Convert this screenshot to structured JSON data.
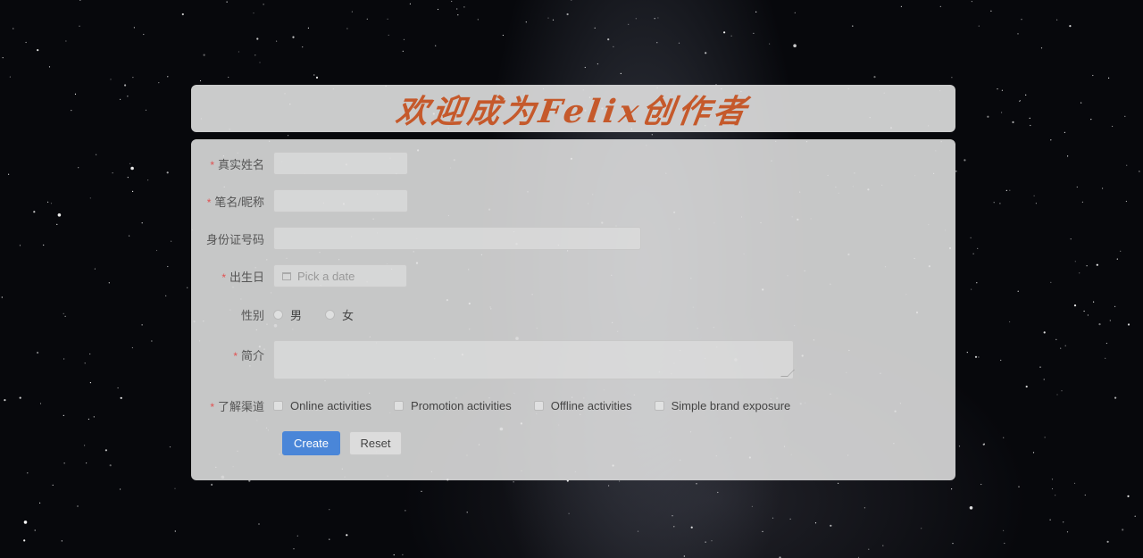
{
  "header": {
    "title": "欢迎成为Felix创作者"
  },
  "form": {
    "real_name": {
      "label": "真实姓名",
      "required": true,
      "value": ""
    },
    "pen_name": {
      "label": "笔名/昵称",
      "required": true,
      "value": ""
    },
    "id_number": {
      "label": "身份证号码",
      "required": false,
      "value": ""
    },
    "birthday": {
      "label": "出生日",
      "required": true,
      "placeholder": "Pick a date"
    },
    "gender": {
      "label": "性别",
      "options": [
        "男",
        "女"
      ]
    },
    "intro": {
      "label": "简介",
      "required": true,
      "value": ""
    },
    "channels": {
      "label": "了解渠道",
      "required": true,
      "options": [
        "Online activities",
        "Promotion activities",
        "Offline activities",
        "Simple brand exposure"
      ]
    },
    "buttons": {
      "create": "Create",
      "reset": "Reset"
    },
    "required_mark": "*"
  },
  "colors": {
    "title": "#c5592b",
    "primary": "#4a86d8",
    "required": "#e05252"
  }
}
